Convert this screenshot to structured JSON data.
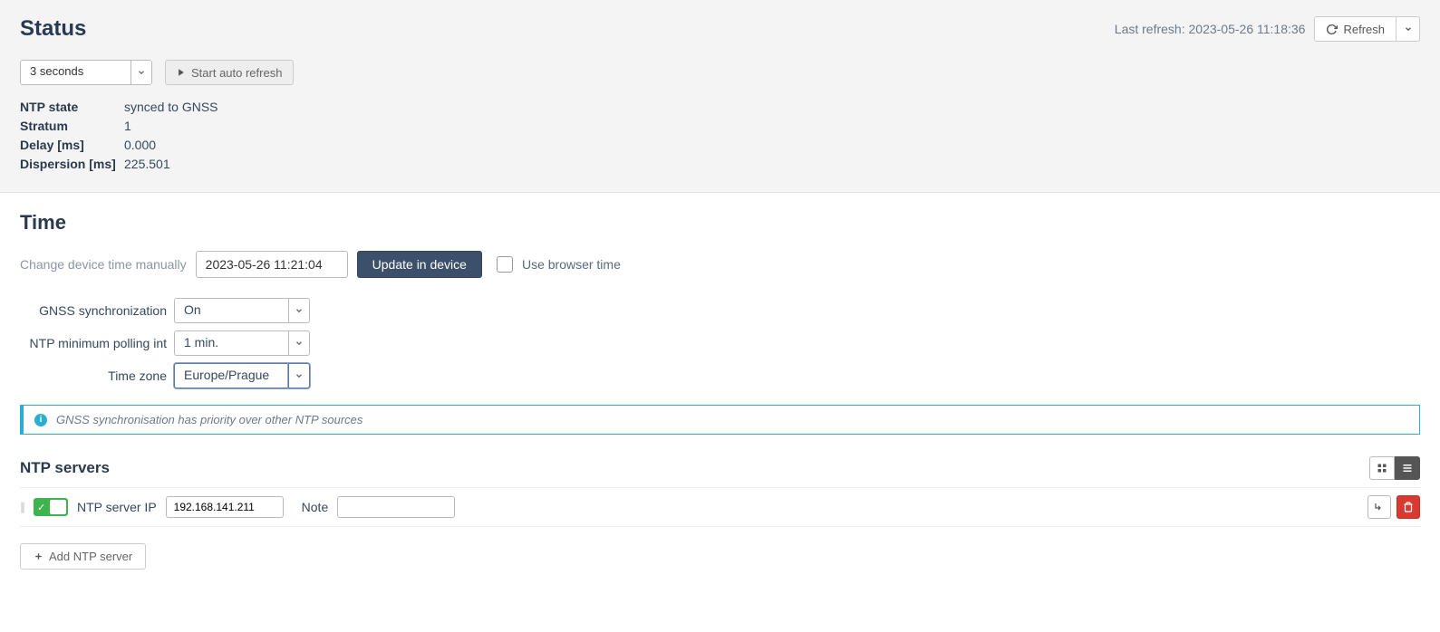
{
  "status": {
    "title": "Status",
    "last_refresh_label": "Last refresh: 2023-05-26 11:18:36",
    "refresh_btn": "Refresh",
    "interval_value": "3 seconds",
    "auto_refresh_btn": "Start auto refresh",
    "kv": {
      "ntp_state_k": "NTP state",
      "ntp_state_v": "synced to GNSS",
      "stratum_k": "Stratum",
      "stratum_v": "1",
      "delay_k": "Delay [ms]",
      "delay_v": "0.000",
      "dispersion_k": "Dispersion [ms]",
      "dispersion_v": "225.501"
    }
  },
  "time": {
    "title": "Time",
    "manual_label": "Change device time manually",
    "manual_value": "2023-05-26 11:21:04",
    "update_btn": "Update in device",
    "browser_time_label": "Use browser time",
    "gnss_sync_label": "GNSS synchronization",
    "gnss_sync_value": "On",
    "min_poll_label": "NTP minimum polling int",
    "min_poll_value": "1 min.",
    "timezone_label": "Time zone",
    "timezone_value": "Europe/Prague",
    "info_text": "GNSS synchronisation has priority over other NTP sources"
  },
  "ntp": {
    "title": "NTP servers",
    "ip_label": "NTP server IP",
    "ip_value": "192.168.141.211",
    "note_label": "Note",
    "note_value": "",
    "add_btn": "Add NTP server"
  }
}
